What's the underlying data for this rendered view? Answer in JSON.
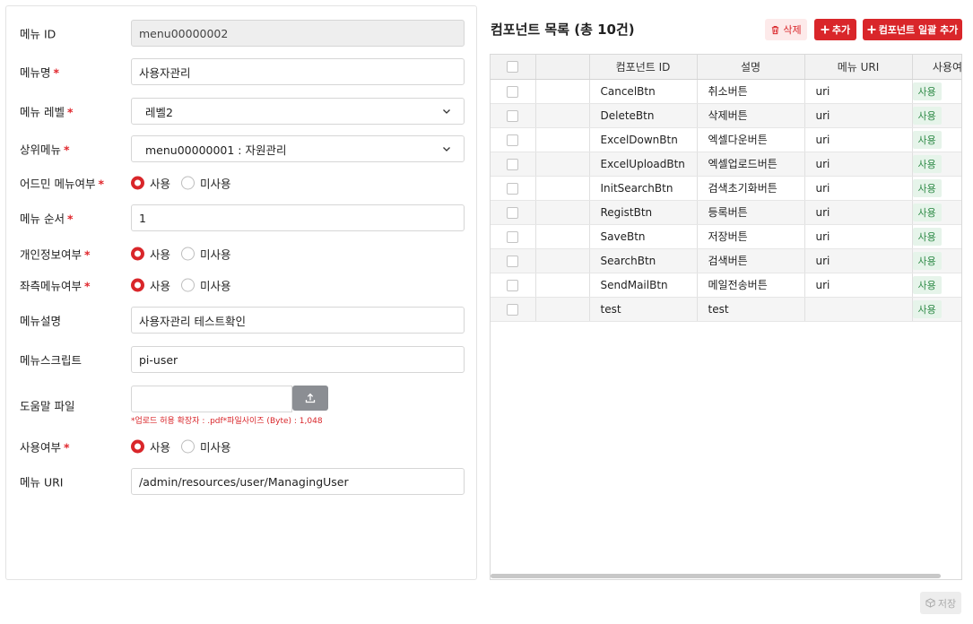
{
  "form": {
    "menu_id": {
      "label": "메뉴 ID",
      "value": "menu00000002"
    },
    "menu_name": {
      "label": "메뉴명",
      "value": "사용자관리"
    },
    "menu_level": {
      "label": "메뉴 레벨",
      "value": "레벨2"
    },
    "parent_menu": {
      "label": "상위메뉴",
      "value": "menu00000001 : 자원관리"
    },
    "admin_menu": {
      "label": "어드민 메뉴여부",
      "options": [
        "사용",
        "미사용"
      ],
      "selected": "사용"
    },
    "menu_order": {
      "label": "메뉴 순서",
      "value": "1"
    },
    "personal_info": {
      "label": "개인정보여부",
      "options": [
        "사용",
        "미사용"
      ],
      "selected": "사용"
    },
    "left_menu": {
      "label": "좌측메뉴여부",
      "options": [
        "사용",
        "미사용"
      ],
      "selected": "사용"
    },
    "menu_desc": {
      "label": "메뉴설명",
      "value": "사용자관리 테스트확인"
    },
    "menu_script": {
      "label": "메뉴스크립트",
      "value": "pi-user"
    },
    "help_file": {
      "label": "도움말 파일",
      "value": "",
      "hint": "*업로드 허용 확장자 : .pdf*파일사이즈 (Byte) : 1,048"
    },
    "use_yn": {
      "label": "사용여부",
      "options": [
        "사용",
        "미사용"
      ],
      "selected": "사용"
    },
    "menu_uri": {
      "label": "메뉴 URI",
      "value": "/admin/resources/user/ManagingUser"
    },
    "required_mark": "*"
  },
  "component_list": {
    "title": "컴포넌트 목록 (총 10건)",
    "buttons": {
      "delete": "삭제",
      "add": "추가",
      "bulk_add": "컴포넌트 일괄 추가"
    },
    "columns": [
      "",
      "",
      "컴포넌트 ID",
      "설명",
      "메뉴 URI",
      "사용여부"
    ],
    "rows": [
      {
        "id": "CancelBtn",
        "desc": "취소버튼",
        "uri": "uri",
        "use": "사용"
      },
      {
        "id": "DeleteBtn",
        "desc": "삭제버튼",
        "uri": "uri",
        "use": "사용"
      },
      {
        "id": "ExcelDownBtn",
        "desc": "엑셀다운버튼",
        "uri": "uri",
        "use": "사용"
      },
      {
        "id": "ExcelUploadBtn",
        "desc": "엑셀업로드버튼",
        "uri": "uri",
        "use": "사용"
      },
      {
        "id": "InitSearchBtn",
        "desc": "검색초기화버튼",
        "uri": "uri",
        "use": "사용"
      },
      {
        "id": "RegistBtn",
        "desc": "등록버튼",
        "uri": "uri",
        "use": "사용"
      },
      {
        "id": "SaveBtn",
        "desc": "저장버튼",
        "uri": "uri",
        "use": "사용"
      },
      {
        "id": "SearchBtn",
        "desc": "검색버튼",
        "uri": "uri",
        "use": "사용"
      },
      {
        "id": "SendMailBtn",
        "desc": "메일전송버튼",
        "uri": "uri",
        "use": "사용"
      },
      {
        "id": "test",
        "desc": "test",
        "uri": "",
        "use": "사용"
      }
    ]
  },
  "footer": {
    "save_label": "저장"
  },
  "colors": {
    "accent": "#d9262a",
    "badge_bg": "#e6f4ea",
    "badge_text": "#2e8a47"
  },
  "icons": [
    "chevron-down-icon",
    "upload-icon",
    "trash-icon",
    "plus-icon",
    "save-icon"
  ]
}
